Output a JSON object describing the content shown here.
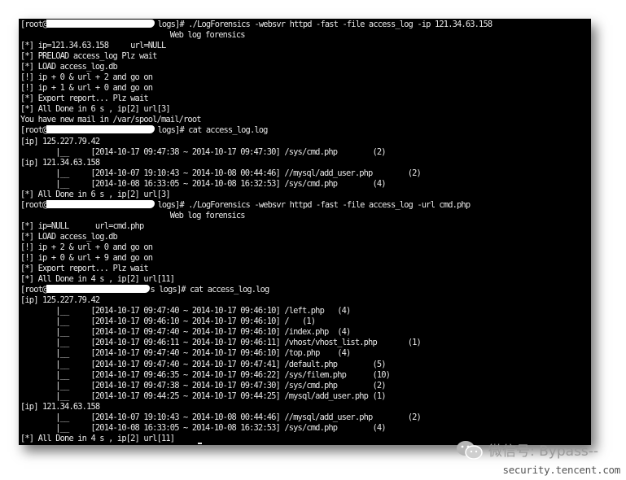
{
  "terminal": {
    "lines": [
      {
        "prefix": "[root@",
        "redacted": true,
        "text": "logs]# ./LogForensics -websvr httpd -fast -file access_log -ip 121.34.63.158"
      },
      {
        "text": "                                  Web log forensics"
      },
      {
        "text": "[*] ip=121.34.63.158     url=NULL"
      },
      {
        "text": "[*] PRELOAD access_log Plz wait"
      },
      {
        "text": "[*] LOAD access_log.db"
      },
      {
        "text": "[!] ip + 0 & url + 2 and go on"
      },
      {
        "text": "[!] ip + 1 & url + 0 and go on"
      },
      {
        "text": "[*] Export report... Plz wait"
      },
      {
        "text": "[*] All Done in 6 s , ip[2] url[3]"
      },
      {
        "text": "You have new mail in /var/spool/mail/root"
      },
      {
        "prefix": "[root@",
        "redacted": true,
        "text": "logs]# cat access_log.log"
      },
      {
        "text": "[ip] 125.227.79.42"
      },
      {
        "text": "        |__     [2014-10-17 09:47:38 ~ 2014-10-17 09:47:30] /sys/cmd.php        (2)"
      },
      {
        "text": "[ip] 121.34.63.158"
      },
      {
        "text": "        |__     [2014-10-07 19:10:43 ~ 2014-10-08 00:44:46] //mysql/add_user.php        (2)"
      },
      {
        "text": "        |__     [2014-10-08 16:33:05 ~ 2014-10-08 16:32:53] /sys/cmd.php        (4)"
      },
      {
        "text": "[*] All Done in 6 s , ip[2] url[3]"
      },
      {
        "prefix": "[root@",
        "redacted": true,
        "text": "logs]# ./LogForensics -websvr httpd -fast -file access_log -url cmd.php"
      },
      {
        "text": "                                  Web log forensics"
      },
      {
        "text": "[*] ip=NULL      url=cmd.php"
      },
      {
        "text": "[*] LOAD access_log.db"
      },
      {
        "text": "[!] ip + 2 & url + 0 and go on"
      },
      {
        "text": "[!] ip + 0 & url + 9 and go on"
      },
      {
        "text": "[*] Export report... Plz wait"
      },
      {
        "text": "[*] All Done in 4 s , ip[2] url[11]"
      },
      {
        "prefix": "[root@",
        "redacted": true,
        "text": "s logs]# cat access_log.log"
      },
      {
        "text": "[ip] 125.227.79.42"
      },
      {
        "text": "        |__     [2014-10-17 09:47:40 ~ 2014-10-17 09:46:10] /left.php   (4)"
      },
      {
        "text": "        |__     [2014-10-17 09:46:10 ~ 2014-10-17 09:46:10] /   (1)"
      },
      {
        "text": "        |__     [2014-10-17 09:47:40 ~ 2014-10-17 09:46:10] /index.php  (4)"
      },
      {
        "text": "        |__     [2014-10-17 09:46:11 ~ 2014-10-17 09:46:11] /vhost/vhost_list.php       (1)"
      },
      {
        "text": "        |__     [2014-10-17 09:47:40 ~ 2014-10-17 09:46:10] /top.php    (4)"
      },
      {
        "text": "        |__     [2014-10-17 09:47:40 ~ 2014-10-17 09:47:41] /default.php        (5)"
      },
      {
        "text": "        |__     [2014-10-17 09:46:35 ~ 2014-10-17 09:46:22] /sys/filem.php      (10)"
      },
      {
        "text": "        |__     [2014-10-17 09:47:38 ~ 2014-10-17 09:47:30] /sys/cmd.php        (2)"
      },
      {
        "text": "        |__     [2014-10-17 09:44:25 ~ 2014-10-17 09:44:25] /mysql/add_user.php (1)"
      },
      {
        "text": "[ip] 121.34.63.158"
      },
      {
        "text": "        |__     [2014-10-07 19:10:43 ~ 2014-10-08 00:44:46] //mysql/add_user.php        (2)"
      },
      {
        "text": "        |__     [2014-10-08 16:33:05 ~ 2014-10-08 16:32:53] /sys/cmd.php        (4)"
      },
      {
        "text": "[*] All Done in 4 s , ip[2] url[11]",
        "cursor": true
      }
    ]
  },
  "watermark": {
    "icon": "wechat-icon",
    "account": "微信号: Bypass--",
    "site": "security.tencent.com"
  },
  "colors": {
    "terminal_bg": "#000000",
    "terminal_fg": "#e8e8e8",
    "redaction": "#ffffff"
  }
}
